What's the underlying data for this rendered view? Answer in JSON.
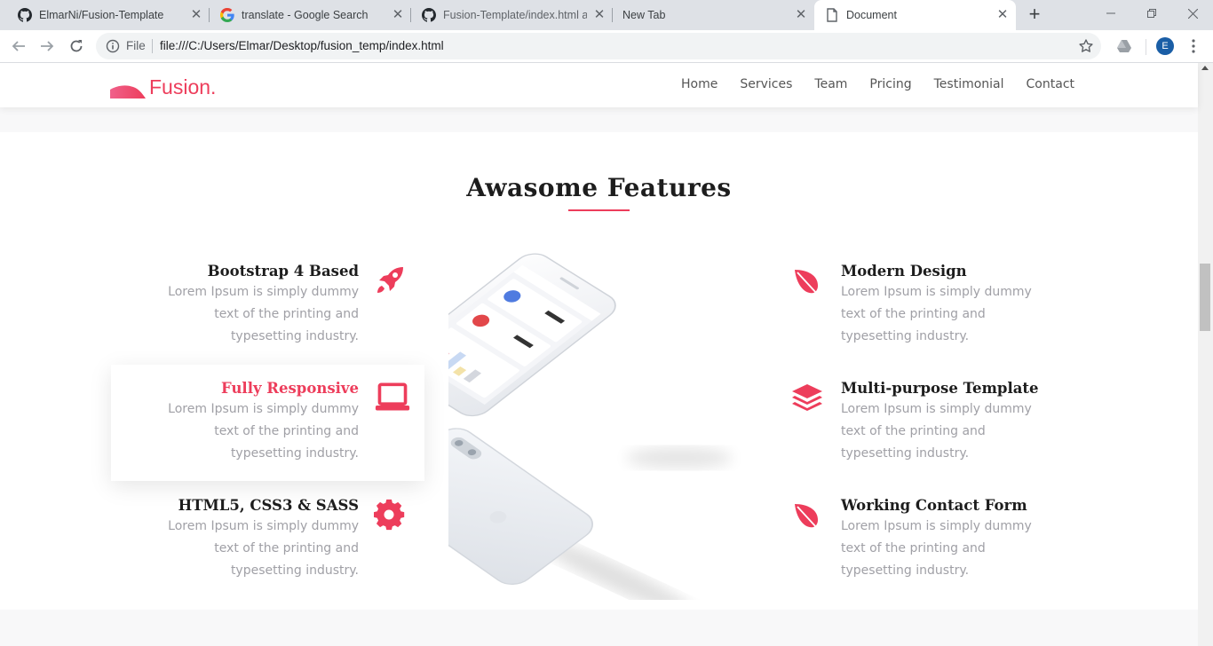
{
  "browser": {
    "tabs": [
      {
        "label": "ElmarNi/Fusion-Template",
        "icon": "github-icon",
        "active": false
      },
      {
        "label": "translate - Google Search",
        "icon": "google-icon",
        "active": false
      },
      {
        "label": "Fusion-Template/index.html at",
        "icon": "github-icon",
        "active": false
      },
      {
        "label": "New Tab",
        "icon": "",
        "active": false
      },
      {
        "label": "Document",
        "icon": "document-icon",
        "active": true
      }
    ],
    "new_tab_symbol": "+",
    "omnibox": {
      "scheme_label": "File",
      "url": "file:///C:/Users/Elmar/Desktop/fusion_temp/index.html"
    },
    "profile_initial": "E"
  },
  "site": {
    "logo_text": "Fusion.",
    "nav": [
      "Home",
      "Services",
      "Team",
      "Pricing",
      "Testimonial",
      "Contact"
    ],
    "accent": "#ed3d5b"
  },
  "features": {
    "title": "Awasome Features",
    "left": [
      {
        "title": "Bootstrap 4 Based",
        "desc": "Lorem Ipsum is simply dummy text of the printing and typesetting industry.",
        "icon": "rocket-icon"
      },
      {
        "title": "Fully Responsive",
        "desc": "Lorem Ipsum is simply dummy text of the printing and typesetting industry.",
        "icon": "laptop-icon",
        "highlighted": true
      },
      {
        "title": "HTML5, CSS3 & SASS",
        "desc": "Lorem Ipsum is simply dummy text of the printing and typesetting industry.",
        "icon": "gear-icon"
      }
    ],
    "right": [
      {
        "title": "Modern Design",
        "desc": "Lorem Ipsum is simply dummy text of the printing and typesetting industry.",
        "icon": "leaf-icon"
      },
      {
        "title": "Multi-purpose Template",
        "desc": "Lorem Ipsum is simply dummy text of the printing and typesetting industry.",
        "icon": "layers-icon"
      },
      {
        "title": "Working Contact Form",
        "desc": "Lorem Ipsum is simply dummy text of the printing and typesetting industry.",
        "icon": "leaf-icon"
      }
    ]
  }
}
